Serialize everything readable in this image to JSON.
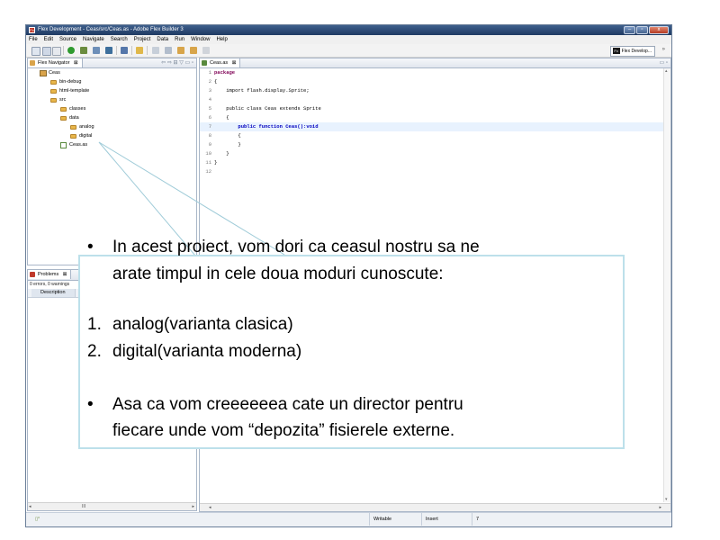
{
  "window": {
    "title": "Flex Development - Ceas/src/Ceas.as - Adobe Flex Builder 3",
    "app_icon": "Fx",
    "controls": [
      "–",
      "▫",
      "x"
    ]
  },
  "menu": [
    "File",
    "Edit",
    "Source",
    "Navigate",
    "Search",
    "Project",
    "Data",
    "Run",
    "Window",
    "Help"
  ],
  "toolbar": {
    "perspective_icon": "Fx",
    "perspective_label": "Flex Develop...",
    "overflow": "»"
  },
  "navigator": {
    "tab_label": "Flex Navigator",
    "tab_close": "⊠",
    "tools": "⇦ ⇨ ⊟ ▽ ▭ ▫",
    "tree": [
      {
        "label": "Ceas"
      },
      {
        "label": "bin-debug"
      },
      {
        "label": "html-template"
      },
      {
        "label": "src"
      },
      {
        "label": "classes"
      },
      {
        "label": "data"
      },
      {
        "label": "analog"
      },
      {
        "label": "digital"
      },
      {
        "label": "Ceas.as"
      }
    ]
  },
  "problems": {
    "tab_label": "Problems",
    "tab_close": "⊠",
    "summary": "0 errors, 0 warnings",
    "column": "Description",
    "scroll_left": "◂",
    "scroll_mid": "III",
    "scroll_right": "▸"
  },
  "editor": {
    "tab_label": "Ceas.as",
    "tab_close": "⊠",
    "tools": "▭ ▫",
    "lines": [
      {
        "num": "1",
        "code": "package"
      },
      {
        "num": "2",
        "code": "{"
      },
      {
        "num": "3",
        "code": "    import flash.display.Sprite;"
      },
      {
        "num": "4",
        "code": ""
      },
      {
        "num": "5",
        "code": "    public class Ceas extends Sprite"
      },
      {
        "num": "6",
        "code": "    {"
      },
      {
        "num": "7",
        "code": "        public function Ceas():void"
      },
      {
        "num": "8",
        "code": "        {"
      },
      {
        "num": "9",
        "code": "        }"
      },
      {
        "num": "10",
        "code": "    }"
      },
      {
        "num": "11",
        "code": "}"
      },
      {
        "num": "12",
        "code": ""
      }
    ],
    "scroll_left": "◂",
    "scroll_right": "▸",
    "scroll_up": "▴",
    "scroll_down": "▾"
  },
  "status": {
    "icon": "▯°",
    "writable": "Writable",
    "insert": "Insert",
    "position": "7"
  },
  "callout": {
    "bullet": "•",
    "p1_line1": "In acest proiect, vom dori ca ceasul nostru sa ne",
    "p1_line2": "arate timpul in cele doua moduri cunoscute:",
    "item1_num": "1.",
    "item1_text": "analog(varianta clasica)",
    "item2_num": "2.",
    "item2_text": "digital(varianta moderna)",
    "p2_line1": "Asa ca vom creeeeeea cate un director pentru",
    "p2_line2": "fiecare unde vom “depozita” fisierele externe."
  },
  "colors": {
    "callout_border": "#bde0ea",
    "callout_pointer": "#9fcbd8",
    "current_line": "#e8f2fe",
    "keyword": "#7f0055",
    "title_bar": "#2b4a77"
  }
}
